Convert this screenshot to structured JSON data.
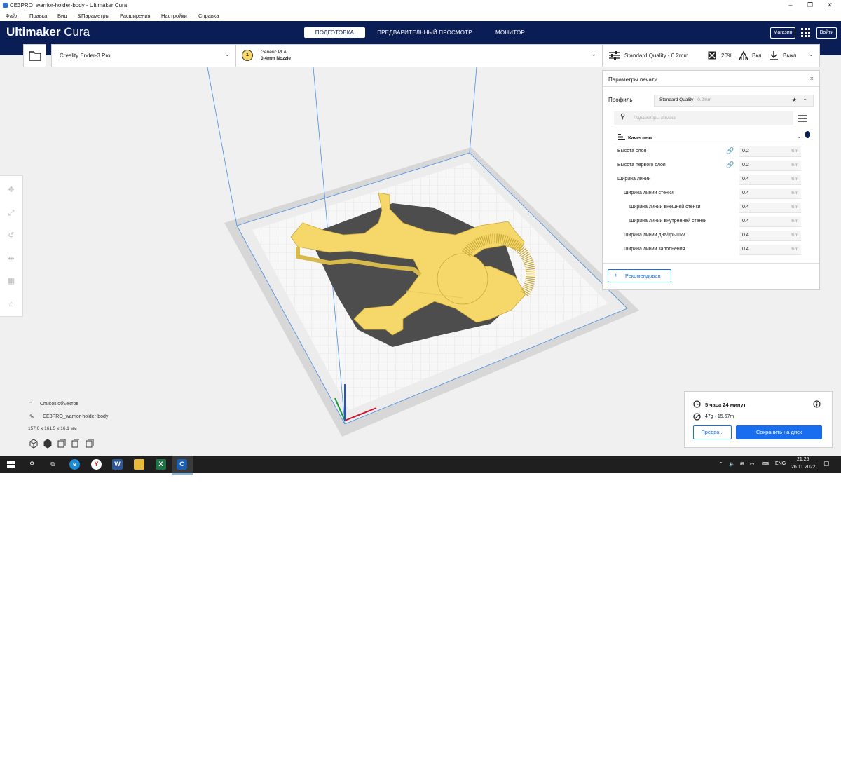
{
  "window": {
    "title": "CE3PRO_warrior-holder-body - Ultimaker Cura",
    "minimize": "–",
    "restore": "❐",
    "close": "✕"
  },
  "menu": [
    "Файл",
    "Правка",
    "Вид",
    "&Параметры",
    "Расширения",
    "Настройки",
    "Справка"
  ],
  "header": {
    "logo_bold": "Ultimaker",
    "logo_light": "Cura",
    "tabs": [
      {
        "label": "ПОДГОТОВКА",
        "active": true
      },
      {
        "label": "ПРЕДВАРИТЕЛЬНЫЙ ПРОСМОТР",
        "active": false
      },
      {
        "label": "МОНИТОР",
        "active": false
      }
    ],
    "marketplace": "Магазин",
    "signin": "Войти"
  },
  "toolbar": {
    "printer": "Creality Ender-3 Pro",
    "extruder_number": "1",
    "material": "Generic PLA",
    "nozzle": "0.4mm Nozzle",
    "quality": "Standard Quality - 0.2mm",
    "infill": "20%",
    "support": "Вкл",
    "adhesion": "Выкл"
  },
  "panel": {
    "title": "Параметры печати",
    "profile_label": "Профиль",
    "profile_value": "Standard Quality",
    "profile_suffix": " - 0.2mm",
    "search_placeholder": "Параметры поиска",
    "category": "Качество",
    "settings": [
      {
        "label": "Высота слоя",
        "value": "0.2",
        "unit": "mm",
        "indent": 0,
        "link": true
      },
      {
        "label": "Высота первого слоя",
        "value": "0.2",
        "unit": "mm",
        "indent": 0,
        "link": true
      },
      {
        "label": "Ширина линии",
        "value": "0.4",
        "unit": "mm",
        "indent": 0,
        "link": false
      },
      {
        "label": "Ширина линии стенки",
        "value": "0.4",
        "unit": "mm",
        "indent": 1,
        "link": false
      },
      {
        "label": "Ширина линии внешней стенки",
        "value": "0.4",
        "unit": "mm",
        "indent": 2,
        "link": false
      },
      {
        "label": "Ширина линии внутренней стенки",
        "value": "0.4",
        "unit": "mm",
        "indent": 2,
        "link": false
      },
      {
        "label": "Ширина линии дна/крышки",
        "value": "0.4",
        "unit": "mm",
        "indent": 1,
        "link": false
      },
      {
        "label": "Ширина линии заполнения",
        "value": "0.4",
        "unit": "mm",
        "indent": 1,
        "link": false
      }
    ],
    "recommended_button": "Рекомендован"
  },
  "objects": {
    "list_label": "Список объектов",
    "object_name": "CE3PRO_warrior-holder-body",
    "dimensions": "157.0 x 161.5 x 16.1 мм"
  },
  "action": {
    "time": "5 часа 24 минут",
    "material": "47g · 15.67m",
    "preview_button": "Предва...",
    "save_button": "Сохранить на диск"
  },
  "taskbar": {
    "lang": "ENG",
    "time": "21:25",
    "date": "26.11.2022"
  },
  "colors": {
    "header": "#0b1d55",
    "accent": "#196ef0",
    "model": "#f6d86a"
  }
}
